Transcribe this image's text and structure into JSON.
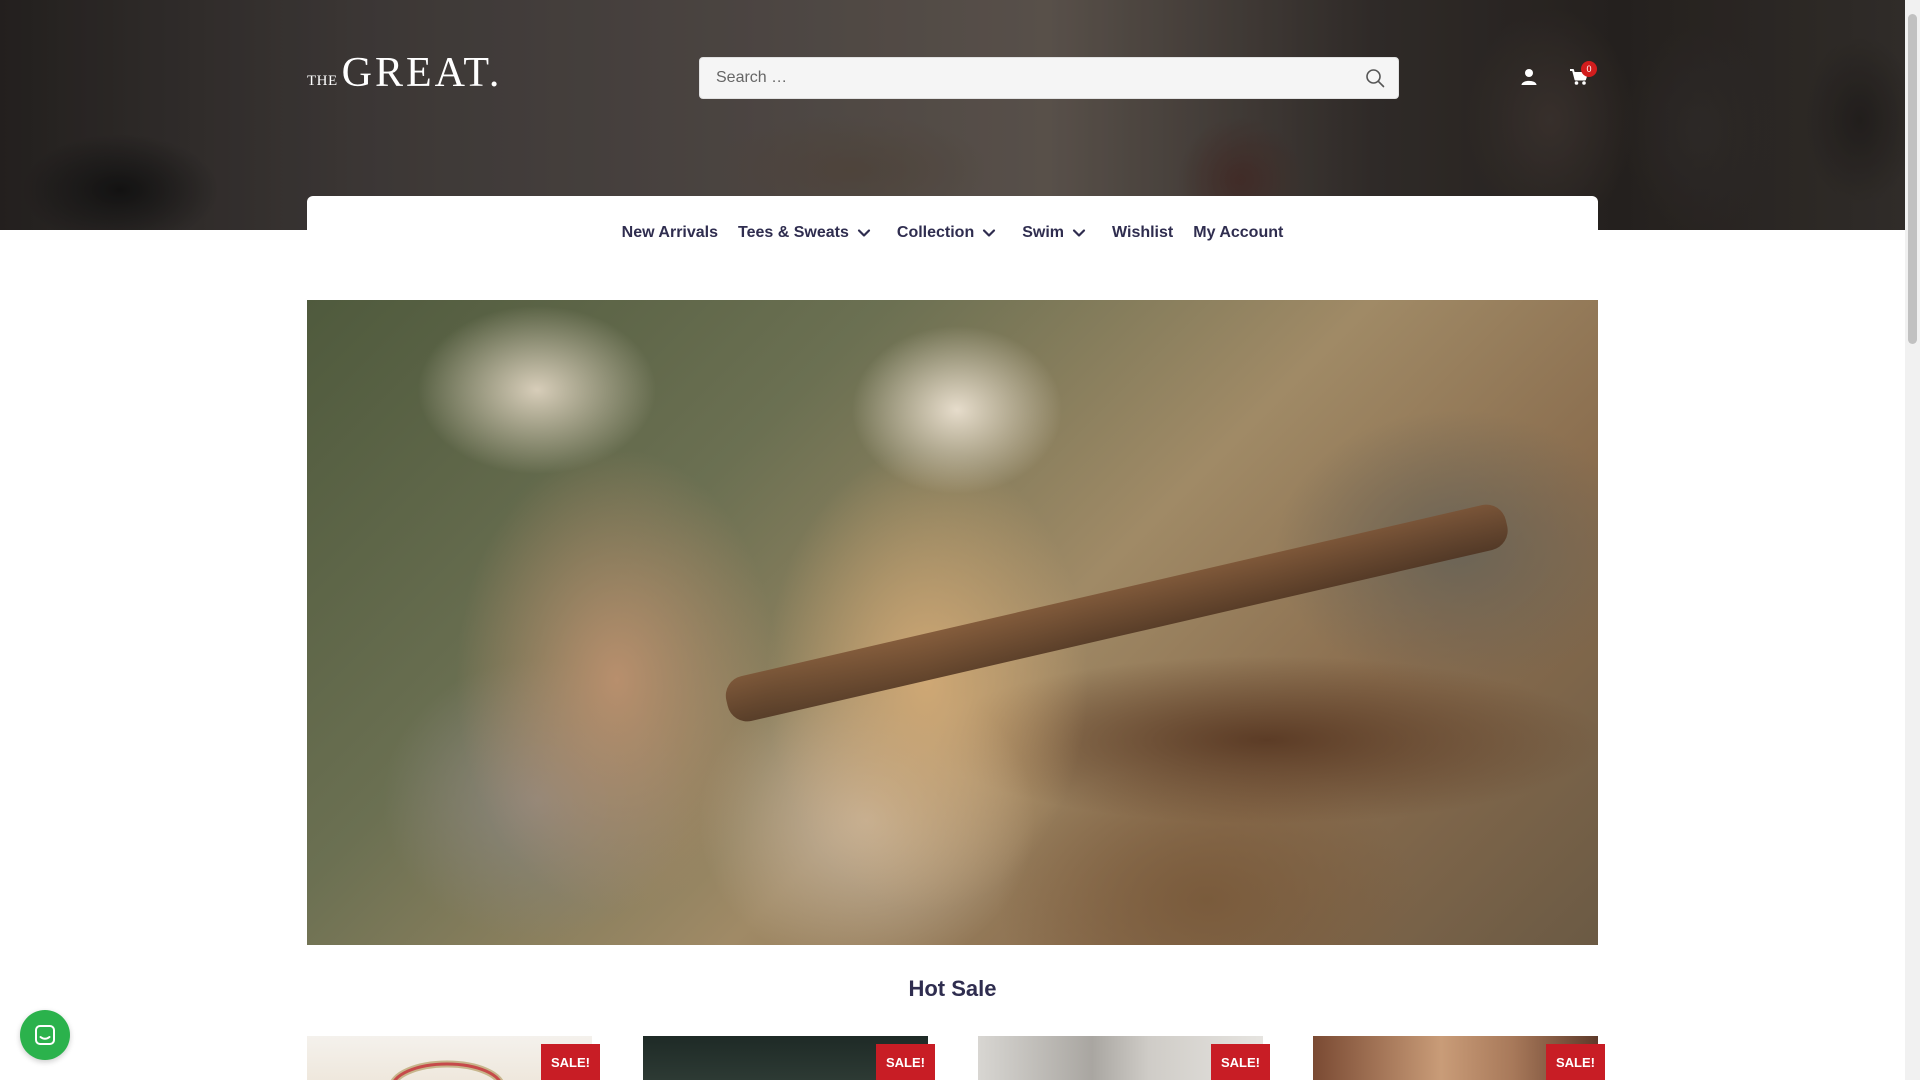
{
  "header": {
    "logo_the": "THE",
    "logo_great": "GREAT.",
    "search_placeholder": "Search …",
    "cart_count": "0"
  },
  "nav": {
    "items": [
      {
        "label": "New Arrivals",
        "dropdown": false
      },
      {
        "label": "Tees & Sweats",
        "dropdown": true
      },
      {
        "label": "Collection",
        "dropdown": true
      },
      {
        "label": "Swim",
        "dropdown": true
      },
      {
        "label": "Wishlist",
        "dropdown": false
      },
      {
        "label": "My Account",
        "dropdown": false
      }
    ]
  },
  "main": {
    "section_title": "Hot Sale",
    "products": [
      {
        "badge": "SALE!"
      },
      {
        "badge": "SALE!"
      },
      {
        "badge": "SALE!"
      },
      {
        "badge": "SALE!"
      }
    ]
  },
  "colors": {
    "nav_text": "#2f2d4f",
    "sale_badge": "#c81d25",
    "cart_badge": "#d21d1d",
    "chat_button": "#2bb24c"
  },
  "icons": [
    "search-icon",
    "user-icon",
    "cart-icon",
    "chevron-down-icon",
    "chat-icon"
  ]
}
